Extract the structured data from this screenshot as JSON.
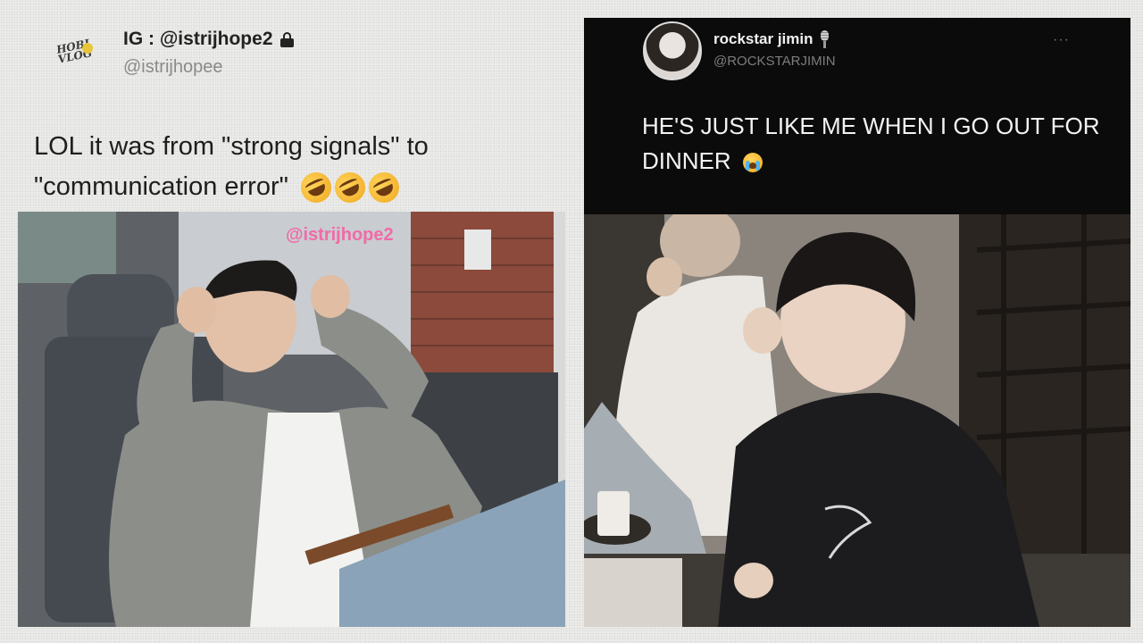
{
  "left_tweet": {
    "avatar_logo_text": "HOBI VLOG",
    "display_name": "IG : @istrijhope2",
    "handle": "@istrijhopee",
    "text": "LOL it was from \"strong signals\" to \"communication error\"",
    "emojis": [
      "rolling-on-floor-laughing",
      "rolling-on-floor-laughing",
      "rolling-on-floor-laughing"
    ],
    "photo_watermark": "@istrijhope2"
  },
  "right_tweet": {
    "display_name": "rockstar jimin",
    "handle": "@ROCKSTARJIMIN",
    "more_glyph": "···",
    "text": "HE'S JUST LIKE ME WHEN I GO OUT FOR DINNER",
    "emoji": "loudly-crying-face"
  },
  "colors": {
    "page_background": "#ececea",
    "dark_tweet_background": "#0b0b0b",
    "handle_gray": "#8a8a8a",
    "watermark_pink": "#f06ba8"
  }
}
